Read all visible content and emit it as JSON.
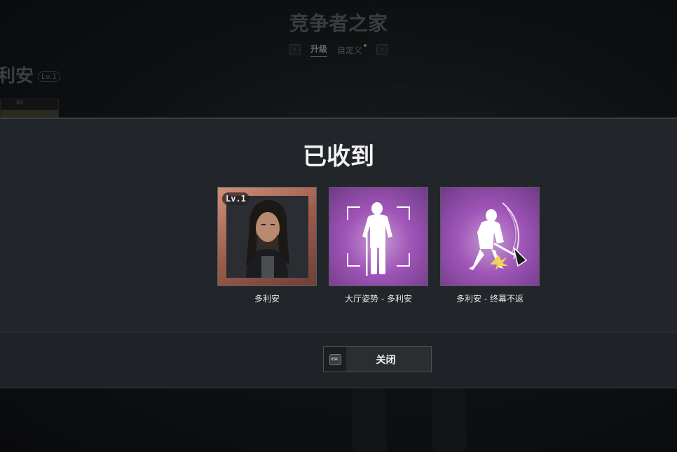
{
  "background": {
    "title": "竞争者之家",
    "tabs": [
      {
        "label": "升级",
        "active": true
      },
      {
        "label": "自定义",
        "active": false
      }
    ],
    "character_name": "利安",
    "character_level": "Lv.1",
    "bar_text": "04"
  },
  "modal": {
    "title": "已收到",
    "items": [
      {
        "label": "多利安",
        "badge": "Lv.1",
        "type": "portrait"
      },
      {
        "label": "大厅姿势 - 多利安",
        "type": "emote"
      },
      {
        "label": "多利安 - 终幕不返",
        "type": "emote"
      }
    ],
    "close_key": "ESC",
    "close_label": "关闭"
  },
  "colors": {
    "modal_bg": "#22252a",
    "emote_purple": "#a055b8",
    "portrait_frame": "#c88a74"
  }
}
